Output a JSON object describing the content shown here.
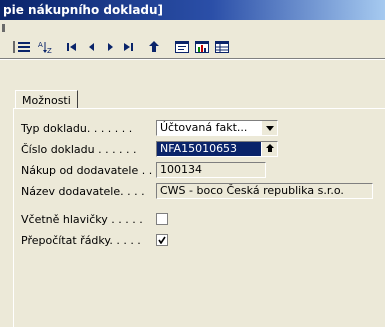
{
  "window": {
    "title": "pie nákupního dokladu]"
  },
  "tabs": [
    {
      "label": "Možnosti"
    }
  ],
  "fields": {
    "typ_dokladu": {
      "label": "Typ dokladu. . . . . . .",
      "value": "Účtovaná fakt..."
    },
    "cislo_dokladu": {
      "label": "Číslo dokladu . . . . . .",
      "value": "NFA15010653"
    },
    "nakup_od_dodavatele": {
      "label": "Nákup od dodavatele . .",
      "value": "100134"
    },
    "nazev_dodavatele": {
      "label": "Název dodavatele. . . .",
      "value": "CWS - boco Česká republika s.r.o."
    },
    "vcetne_hlavicky": {
      "label": "Včetně hlavičky . . . . .",
      "checked": false
    },
    "prepocitat_radky": {
      "label": "Přepočítat řádky. . . . .",
      "checked": true
    }
  },
  "toolbar_icons": [
    "list-icon",
    "sort-icon",
    "first-record-icon",
    "previous-record-icon",
    "next-record-icon",
    "last-record-icon",
    "up-arrow-icon",
    "form-icon",
    "chart-icon",
    "table-icon"
  ]
}
